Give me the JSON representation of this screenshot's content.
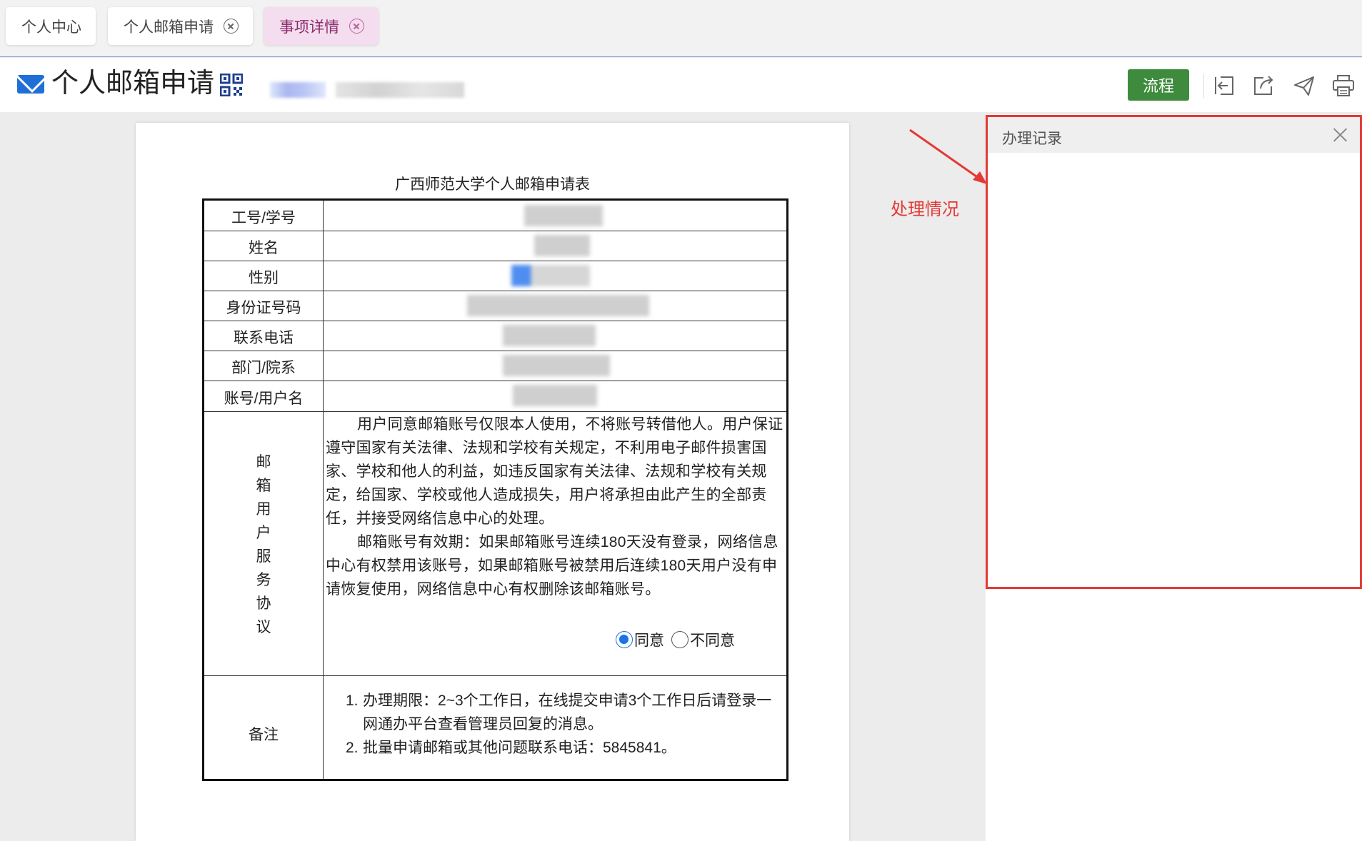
{
  "tabs": [
    {
      "label": "个人中心",
      "closable": false,
      "active": false
    },
    {
      "label": "个人邮箱申请",
      "closable": true,
      "active": false
    },
    {
      "label": "事项详情",
      "closable": true,
      "active": true
    }
  ],
  "header": {
    "title": "个人邮箱申请",
    "title_icon": "mail-icon",
    "qr_icon": "qr-code-icon",
    "flow_button": "流程",
    "toolbar_icons": [
      "back-icon",
      "share-icon",
      "send-icon",
      "print-icon"
    ]
  },
  "document": {
    "title": "广西师范大学个人邮箱申请表",
    "fields": [
      "工号/学号",
      "姓名",
      "性别",
      "身份证号码",
      "联系电话",
      "部门/院系",
      "账号/用户名"
    ],
    "agreement_label": "邮箱用户服务协议",
    "agreement_chars": [
      "邮",
      "箱",
      "用",
      "户",
      "服",
      "务",
      "协",
      "议"
    ],
    "agreement_p1": "用户同意邮箱账号仅限本人使用，不将账号转借他人。用户保证遵守国家有关法律、法规和学校有关规定，不利用电子邮件损害国家、学校和他人的利益，如违反国家有关法律、法规和学校有关规定，给国家、学校或他人造成损失，用户将承担由此产生的全部责任，并接受网络信息中心的处理。",
    "agreement_p2": "邮箱账号有效期：如果邮箱账号连续180天没有登录，网络信息中心有权禁用该账号，如果邮箱账号被禁用后连续180天用户没有申请恢复使用，网络信息中心有权删除该邮箱账号。",
    "agree_option": "同意",
    "disagree_option": "不同意",
    "selected": "同意",
    "remarks_label": "备注",
    "remarks": [
      {
        "num": "1.",
        "text": "办理期限：2~3个工作日，在线提交申请3个工作日后请登录一网通办平台查看管理员回复的消息。"
      },
      {
        "num": "2.",
        "text": "批量申请邮箱或其他问题联系电话：5845841。"
      }
    ]
  },
  "annotation": {
    "text": "处理情况",
    "color": "#e53935"
  },
  "record_panel": {
    "title": "办理记录"
  },
  "colors": {
    "accent_green": "#3e8b3e",
    "active_tab_bg": "#f4ddee",
    "active_tab_text": "#8b2a6b",
    "mail_blue": "#1f6fd6",
    "annotation_red": "#e53935"
  }
}
